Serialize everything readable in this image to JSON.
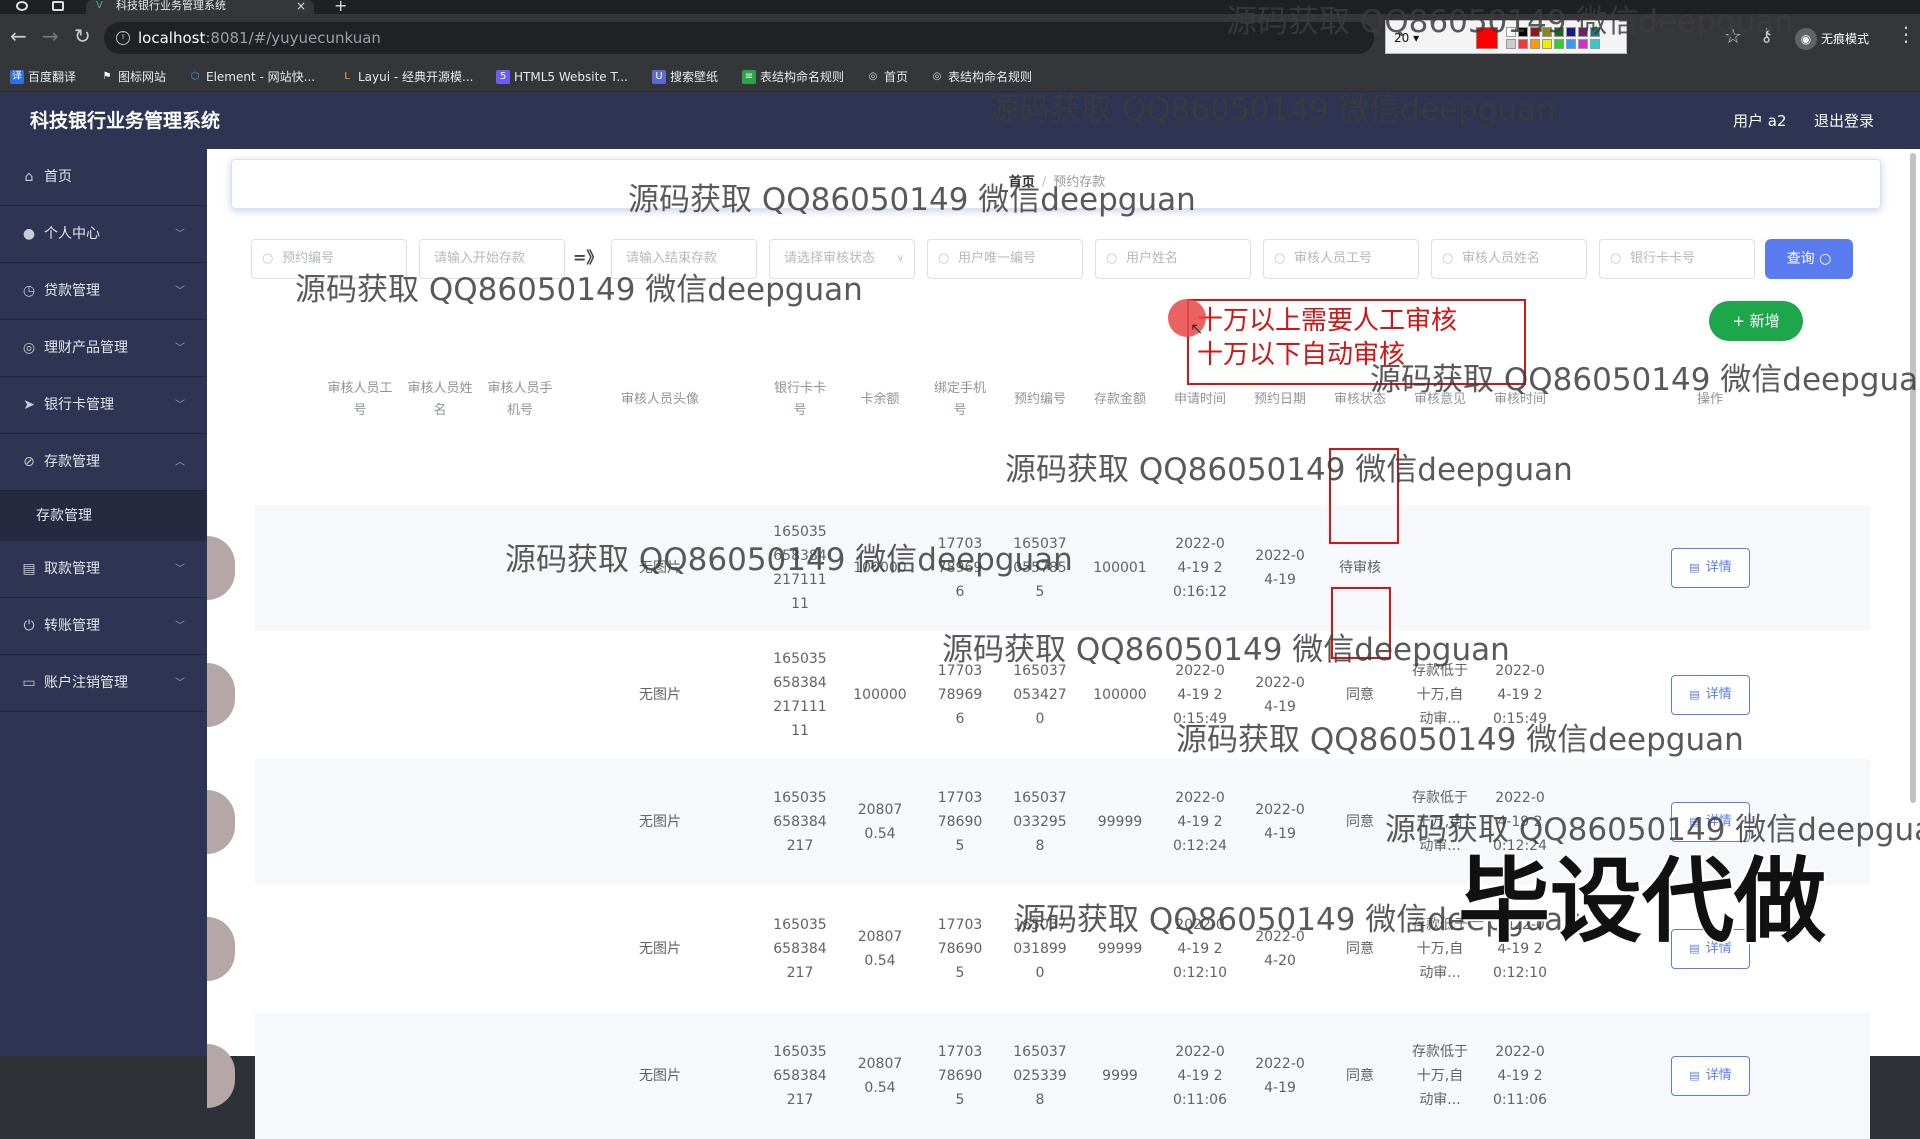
{
  "browser": {
    "tab_title": "科技银行业务管理系统",
    "url_host": "localhost",
    "url_path": ":8081/#/yuyuecunkuan",
    "incognito_label": "无痕模式",
    "pen_size": "20",
    "bookmarks": [
      {
        "label": "百度翻译",
        "icon_color": "#2f6ee8",
        "icon_glyph": "译"
      },
      {
        "label": "图标网站",
        "icon_color": "#ffffff",
        "icon_glyph": "⚑"
      },
      {
        "label": "Element - 网站快...",
        "icon_color": "#409eff",
        "icon_glyph": "⬡"
      },
      {
        "label": "Layui - 经典开源模...",
        "icon_color": "#d4b03a",
        "icon_glyph": "L"
      },
      {
        "label": "HTML5 Website T...",
        "icon_color": "#6b5cf6",
        "icon_glyph": "5"
      },
      {
        "label": "搜索壁纸",
        "icon_color": "#5b6ad0",
        "icon_glyph": "U"
      },
      {
        "label": "表结构命名规则",
        "icon_color": "#2aa34a",
        "icon_glyph": "≡"
      },
      {
        "label": "首页",
        "icon_color": "#dddddd",
        "icon_glyph": "◎"
      },
      {
        "label": "表结构命名规则",
        "icon_color": "#dddddd",
        "icon_glyph": "◎"
      }
    ]
  },
  "header": {
    "app_title": "科技银行业务管理系统",
    "user_label": "用户 a2",
    "logout": "退出登录"
  },
  "sidebar": {
    "items": [
      {
        "label": "首页",
        "icon": "home-icon",
        "glyph": "⌂"
      },
      {
        "label": "个人中心",
        "icon": "user-icon",
        "glyph": "👤"
      },
      {
        "label": "贷款管理",
        "icon": "loan-icon",
        "glyph": "◷"
      },
      {
        "label": "理财产品管理",
        "icon": "finance-icon",
        "glyph": "◎"
      },
      {
        "label": "银行卡管理",
        "icon": "card-icon",
        "glyph": "➤"
      },
      {
        "label": "存款管理",
        "icon": "deposit-icon",
        "glyph": "⊘"
      },
      {
        "label": "取款管理",
        "icon": "withdraw-icon",
        "glyph": "▤"
      },
      {
        "label": "转账管理",
        "icon": "transfer-icon",
        "glyph": "⏻"
      },
      {
        "label": "账户注销管理",
        "icon": "account-icon",
        "glyph": "▭"
      }
    ],
    "sub_item": "存款管理"
  },
  "breadcrumb": {
    "home": "首页",
    "sep": "/",
    "current": "预约存款"
  },
  "filters": {
    "reservation_no": "预约编号",
    "start_amount": "请输入开始存款",
    "range_sep": "=》",
    "end_amount": "请输入结束存款",
    "status_select": "请选择审核状态",
    "user_id": "用户唯一编号",
    "user_name": "用户姓名",
    "auditor_no": "审核人员工号",
    "auditor_name": "审核人员姓名",
    "card_no": "银行卡卡号",
    "search_btn": "查询",
    "add_btn": "新增"
  },
  "annotation": {
    "line1": "十万以上需要人工审核",
    "line2": "十万以下自动审核"
  },
  "table": {
    "headers": {
      "auditor_no": "审核人员工号",
      "auditor_name": "审核人员姓名",
      "auditor_phone": "审核人员手机号",
      "auditor_avatar": "审核人员头像",
      "card_no": "银行卡卡号",
      "balance": "卡余额",
      "phone": "绑定手机号",
      "reservation_no": "预约编号",
      "amount": "存款金额",
      "apply_time": "申请时间",
      "reserve_date": "预约日期",
      "status": "审核状态",
      "opinion": "审核意见",
      "audit_time": "审核时间",
      "action": "操作"
    },
    "detail_label": "详情",
    "rows": [
      {
        "avatar": "无图片",
        "card": "16503565838421711111",
        "balance": "100000",
        "phone": "17703789696",
        "resv": "1650370557855",
        "amount": "100001",
        "apply": "2022-04-19 20:16:12",
        "date": "2022-04-19",
        "status": "待审核",
        "opinion": "",
        "audit": ""
      },
      {
        "avatar": "无图片",
        "card": "16503565838421711111",
        "balance": "100000",
        "phone": "17703789696",
        "resv": "1650370534270",
        "amount": "100000",
        "apply": "2022-04-19 20:15:49",
        "date": "2022-04-19",
        "status": "同意",
        "opinion": "存款低于十万,自动审...",
        "audit": "2022-04-19 20:15:49"
      },
      {
        "avatar": "无图片",
        "card": "165035658384217",
        "balance": "208070.54",
        "phone": "17703786905",
        "resv": "1650370332958",
        "amount": "99999",
        "apply": "2022-04-19 20:12:24",
        "date": "2022-04-19",
        "status": "同意",
        "opinion": "存款低于十万,自动审...",
        "audit": "2022-04-19 20:12:24"
      },
      {
        "avatar": "无图片",
        "card": "165035658384217",
        "balance": "208070.54",
        "phone": "17703786905",
        "resv": "1650370318990",
        "amount": "99999",
        "apply": "2022-04-19 20:12:10",
        "date": "2022-04-20",
        "status": "同意",
        "opinion": "存款低于十万,自动审...",
        "audit": "2022-04-19 20:12:10"
      },
      {
        "avatar": "无图片",
        "card": "165035658384217",
        "balance": "208070.54",
        "phone": "17703786905",
        "resv": "1650370253398",
        "amount": "9999",
        "apply": "2022-04-19 20:11:06",
        "date": "2022-04-19",
        "status": "同意",
        "opinion": "存款低于十万,自动审...",
        "audit": "2022-04-19 20:11:06"
      }
    ]
  },
  "watermark": "源码获取 QQ86050149 微信deepguan",
  "stamp": "毕设代做"
}
